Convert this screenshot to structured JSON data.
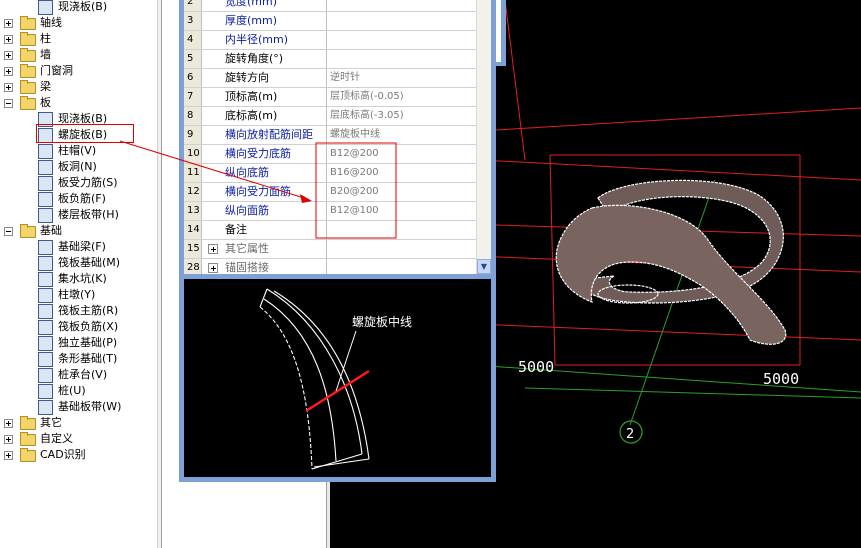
{
  "tree": {
    "items": [
      {
        "label": "现浇板(B)",
        "level": 2
      },
      {
        "label": "轴线",
        "level": 1,
        "expander": "plus"
      },
      {
        "label": "柱",
        "level": 1,
        "expander": "plus"
      },
      {
        "label": "墙",
        "level": 1,
        "expander": "plus"
      },
      {
        "label": "门窗洞",
        "level": 1,
        "expander": "plus"
      },
      {
        "label": "梁",
        "level": 1,
        "expander": "plus"
      },
      {
        "label": "板",
        "level": 1,
        "expander": "minus"
      },
      {
        "label": "现浇板(B)",
        "level": 2
      },
      {
        "label": "螺旋板(B)",
        "level": 2,
        "selected": true
      },
      {
        "label": "柱帽(V)",
        "level": 2
      },
      {
        "label": "板洞(N)",
        "level": 2
      },
      {
        "label": "板受力筋(S)",
        "level": 2
      },
      {
        "label": "板负筋(F)",
        "level": 2
      },
      {
        "label": "楼层板带(H)",
        "level": 2
      },
      {
        "label": "基础",
        "level": 1,
        "expander": "minus"
      },
      {
        "label": "基础梁(F)",
        "level": 2
      },
      {
        "label": "筏板基础(M)",
        "level": 2
      },
      {
        "label": "集水坑(K)",
        "level": 2
      },
      {
        "label": "柱墩(Y)",
        "level": 2
      },
      {
        "label": "筏板主筋(R)",
        "level": 2
      },
      {
        "label": "筏板负筋(X)",
        "level": 2
      },
      {
        "label": "独立基础(P)",
        "level": 2
      },
      {
        "label": "条形基础(T)",
        "level": 2
      },
      {
        "label": "桩承台(V)",
        "level": 2
      },
      {
        "label": "桩(U)",
        "level": 2
      },
      {
        "label": "基础板带(W)",
        "level": 2
      },
      {
        "label": "其它",
        "level": 1,
        "expander": "plus"
      },
      {
        "label": "自定义",
        "level": 1,
        "expander": "plus"
      },
      {
        "label": "CAD识别",
        "level": 1,
        "expander": "plus"
      }
    ]
  },
  "properties": {
    "rows": [
      {
        "num": "2",
        "name": "宽度(mm)",
        "value": "",
        "blue": true
      },
      {
        "num": "3",
        "name": "厚度(mm)",
        "value": "",
        "blue": true
      },
      {
        "num": "4",
        "name": "内半径(mm)",
        "value": "",
        "blue": true
      },
      {
        "num": "5",
        "name": "旋转角度(°)",
        "value": "",
        "blue": false
      },
      {
        "num": "6",
        "name": "旋转方向",
        "value": "逆时针",
        "blue": false
      },
      {
        "num": "7",
        "name": "顶标高(m)",
        "value": "层顶标高(-0.05)",
        "blue": false
      },
      {
        "num": "8",
        "name": "底标高(m)",
        "value": "层底标高(-3.05)",
        "blue": false
      },
      {
        "num": "9",
        "name": "横向放射配筋间距",
        "value": "螺旋板中线",
        "blue": true
      },
      {
        "num": "10",
        "name": "横向受力底筋",
        "value": "B12@200",
        "blue": true
      },
      {
        "num": "11",
        "name": "纵向底筋",
        "value": "B16@200",
        "blue": true
      },
      {
        "num": "12",
        "name": "横向受力面筋",
        "value": "B20@200",
        "blue": true
      },
      {
        "num": "13",
        "name": "纵向面筋",
        "value": "B12@100",
        "blue": true
      },
      {
        "num": "14",
        "name": "备注",
        "value": "",
        "blue": false
      },
      {
        "num": "15",
        "name": "其它属性",
        "value": "",
        "blue": false,
        "group": true
      },
      {
        "num": "28",
        "name": "锚固搭接",
        "value": "",
        "blue": false,
        "group": true
      }
    ]
  },
  "preview": {
    "annotation": "螺旋板中线"
  },
  "view3d": {
    "dim_left": "5000",
    "dim_right": "5000",
    "axis_label": "2"
  },
  "colors": {
    "highlight": "#e00000",
    "dialog_frame": "#7fa0d6",
    "canvas": "#000000"
  }
}
